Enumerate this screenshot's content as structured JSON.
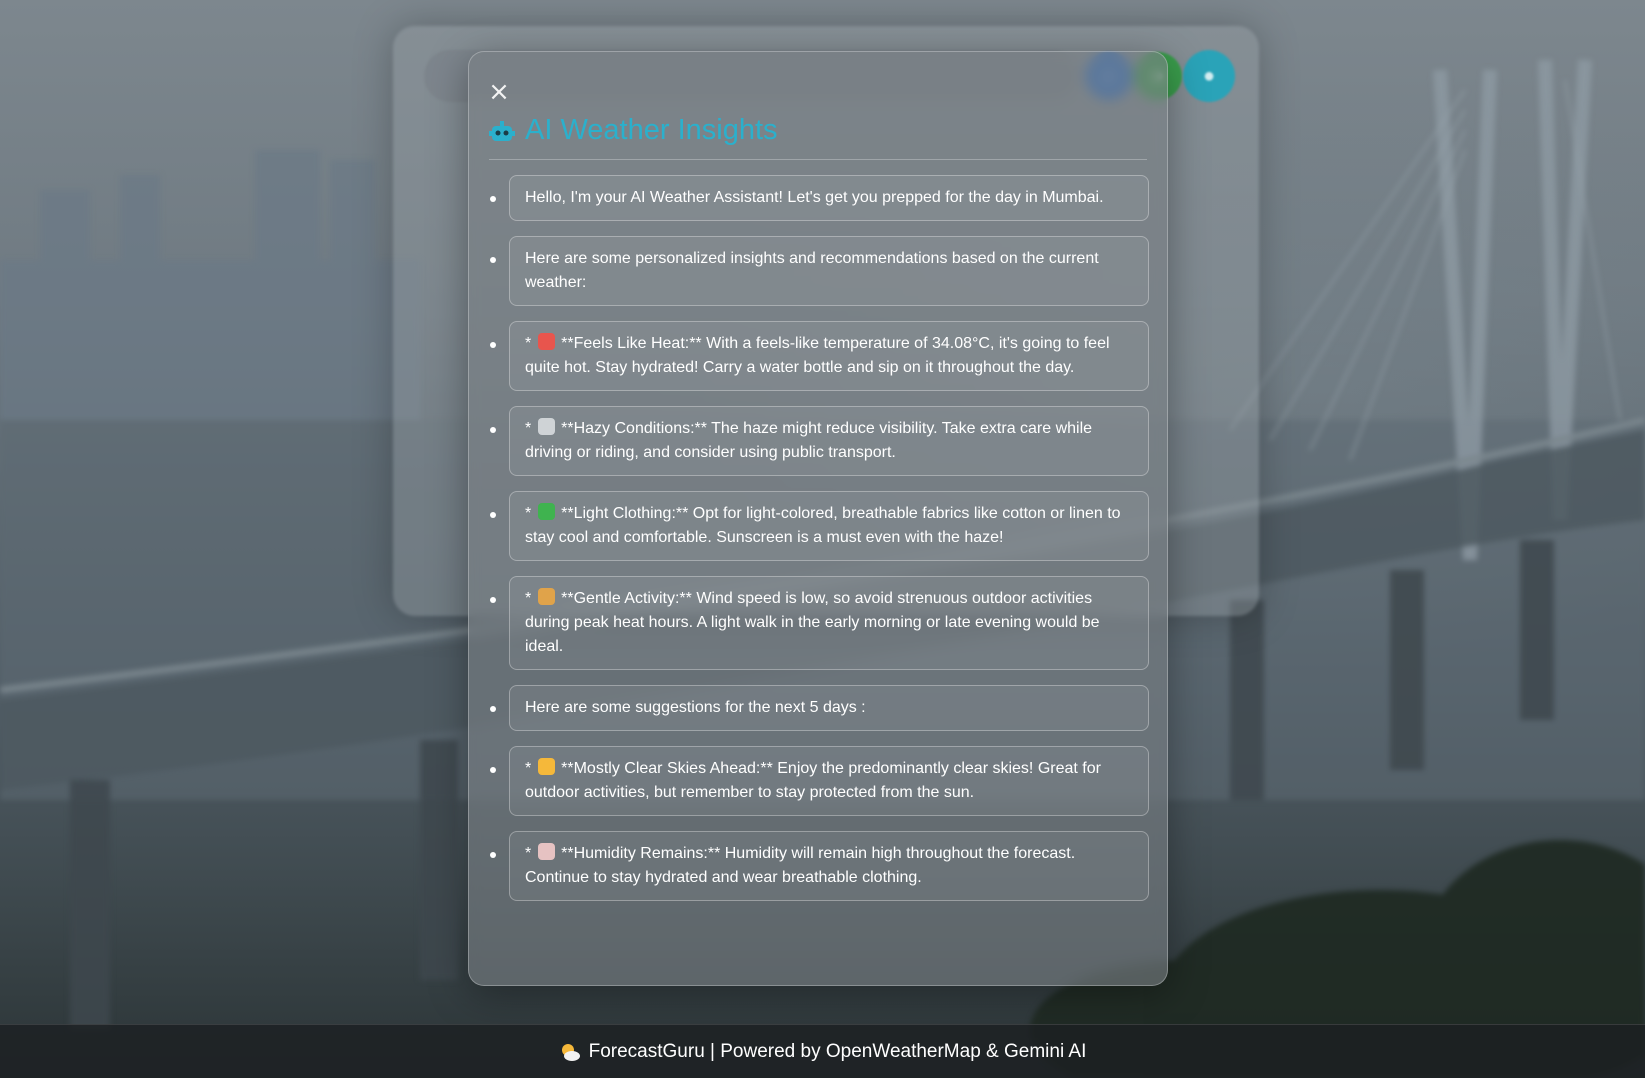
{
  "modal": {
    "close_label": "×",
    "title": "AI Weather Insights",
    "title_icon": "robot-icon",
    "accent_color": "#2bb0cc",
    "insights": [
      {
        "text": "Hello, I'm your AI Weather Assistant! Let's get you prepped for the day in Mumbai."
      },
      {
        "text": "Here are some personalized insights and recommendations based on the current weather:"
      },
      {
        "prefix": "*",
        "icon": "hot-face-icon",
        "icon_color": "#e8554d",
        "text": "**Feels Like Heat:** With a feels-like temperature of 34.08°C, it's going to feel quite hot. Stay hydrated! Carry a water bottle and sip on it throughout the day."
      },
      {
        "prefix": "*",
        "icon": "fog-icon",
        "icon_color": "#cfd3d6",
        "text": "**Hazy Conditions:** The haze might reduce visibility. Take extra care while driving or riding, and consider using public transport."
      },
      {
        "prefix": "*",
        "icon": "t-shirt-icon",
        "icon_color": "#3fb34f",
        "text": "**Light Clothing:** Opt for light-colored, breathable fabrics like cotton or linen to stay cool and comfortable. Sunscreen is a must even with the haze!"
      },
      {
        "prefix": "*",
        "icon": "walking-person-icon",
        "icon_color": "#e0a34a",
        "text": "**Gentle Activity:** Wind speed is low, so avoid strenuous outdoor activities during peak heat hours. A light walk in the early morning or late evening would be ideal."
      },
      {
        "text": "Here are some suggestions for the next 5 days :"
      },
      {
        "prefix": "*",
        "icon": "sun-behind-cloud-icon",
        "icon_color": "#f5b83a",
        "text": "**Mostly Clear Skies Ahead:** Enjoy the predominantly clear skies! Great for outdoor activities, but remember to stay protected from the sun."
      },
      {
        "prefix": "*",
        "icon": "lotion-bottle-icon",
        "icon_color": "#e6c2c2",
        "text": "**Humidity Remains:** Humidity will remain high throughout the forecast. Continue to stay hydrated and wear breathable clothing."
      }
    ]
  },
  "footer": {
    "icon": "sun-behind-cloud-icon",
    "text": "ForecastGuru | Powered by OpenWeatherMap & Gemini AI"
  },
  "background_app": {
    "search_icon": "search-icon",
    "mic_icon": "microphone-icon",
    "ai_icon": "robot-icon"
  }
}
